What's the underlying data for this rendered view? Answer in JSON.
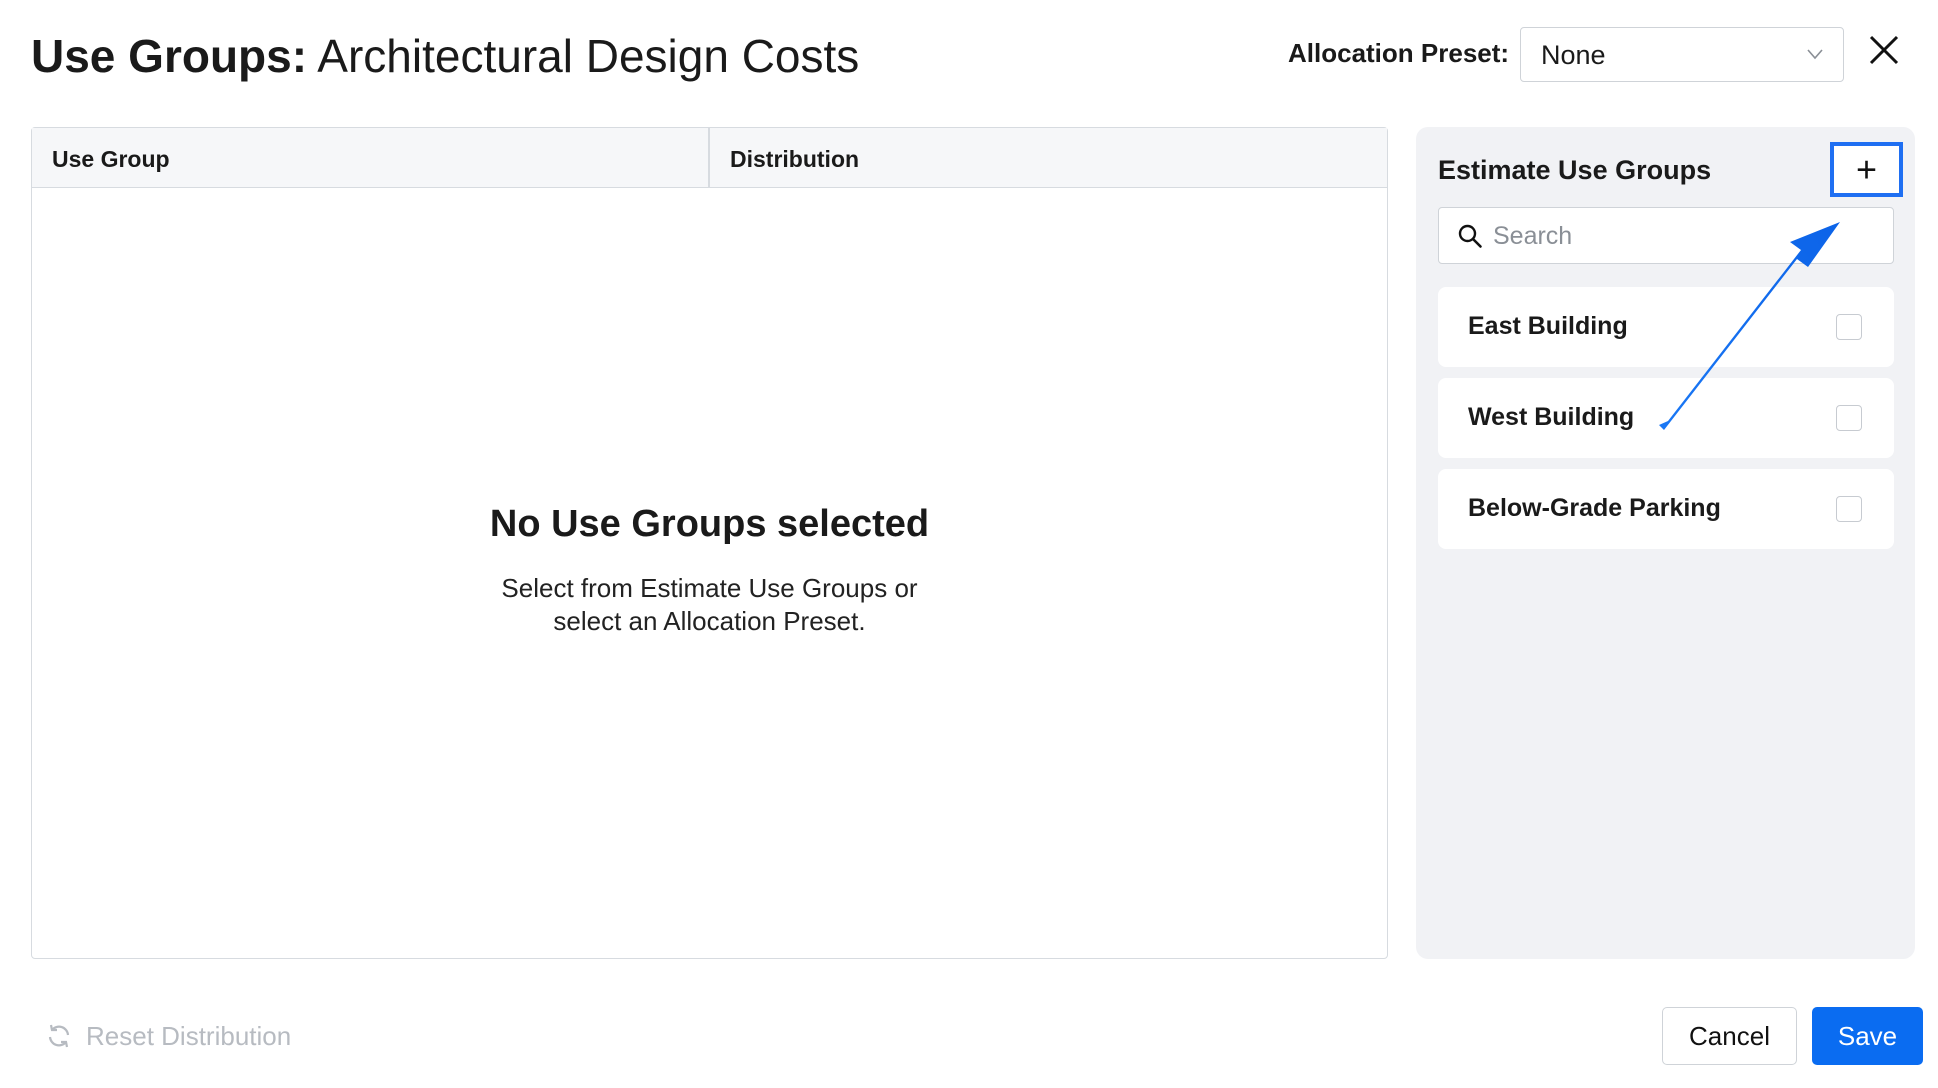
{
  "header": {
    "title_bold": "Use Groups:",
    "title_rest": "Architectural Design Costs",
    "preset_label": "Allocation Preset:",
    "preset_value": "None"
  },
  "table": {
    "columns": [
      "Use Group",
      "Distribution"
    ],
    "empty_title": "No Use Groups selected",
    "empty_line1": "Select from Estimate Use Groups or",
    "empty_line2": "select an Allocation Preset."
  },
  "side": {
    "title": "Estimate Use Groups",
    "add_label": "+",
    "search_placeholder": "Search",
    "items": [
      {
        "label": "East Building",
        "checked": false
      },
      {
        "label": "West Building",
        "checked": false
      },
      {
        "label": "Below-Grade Parking",
        "checked": false
      }
    ]
  },
  "footer": {
    "reset_label": "Reset Distribution",
    "cancel_label": "Cancel",
    "save_label": "Save"
  },
  "icons": {
    "close": "close-icon",
    "chevron": "chevron-down-icon",
    "search": "search-icon",
    "reset": "refresh-icon"
  },
  "colors": {
    "accent": "#0a6cf1",
    "highlight": "#1f6ff2",
    "panel_bg": "#f1f2f5",
    "disabled_text": "#b7bbc1"
  }
}
